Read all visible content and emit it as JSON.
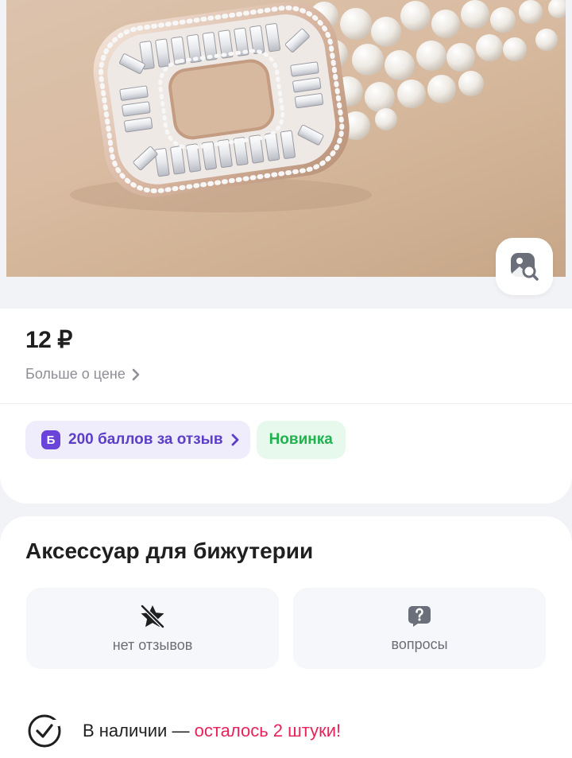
{
  "product": {
    "price": "12 ₽",
    "more_price_label": "Больше о цене",
    "chips": {
      "points_badge": "Б",
      "points_label": "200 баллов за отзыв",
      "new_label": "Новинка"
    },
    "title": "Аксессуар для бижутерии",
    "tiles": {
      "reviews_label": "нет отзывов",
      "questions_label": "вопросы"
    },
    "stock": {
      "status": "В наличии —",
      "remaining": "осталось 2 штуки!"
    }
  },
  "icons": {
    "image_search": "image-search-icon",
    "chevron": "chevron-right-icon",
    "no_reviews": "star-slash-icon",
    "questions": "question-bubble-icon",
    "in_stock": "check-circle-icon"
  },
  "colors": {
    "accent_purple": "#5c3fc7",
    "green": "#1fb24f",
    "warning": "#e7235a"
  }
}
